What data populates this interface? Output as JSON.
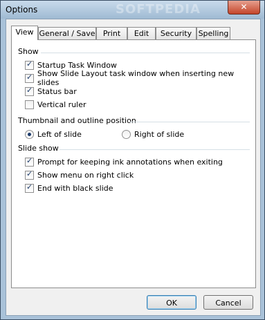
{
  "window": {
    "title": "Options",
    "watermark": "SOFTPEDIA",
    "close_label": "✕"
  },
  "tabs": [
    {
      "label": "View",
      "active": true
    },
    {
      "label": "General / Save",
      "active": false
    },
    {
      "label": "Print",
      "active": false
    },
    {
      "label": "Edit",
      "active": false
    },
    {
      "label": "Security",
      "active": false
    },
    {
      "label": "Spelling",
      "active": false
    }
  ],
  "show": {
    "heading": "Show",
    "options": [
      {
        "label": "Startup Task Window",
        "checked": true
      },
      {
        "label": "Show Slide Layout task window when inserting new slides",
        "checked": true
      },
      {
        "label": "Status bar",
        "checked": true
      },
      {
        "label": "Vertical ruler",
        "checked": false
      }
    ]
  },
  "thumbnail": {
    "heading": "Thumbnail and outline position",
    "options": [
      {
        "label": "Left of slide",
        "selected": true
      },
      {
        "label": "Right of slide",
        "selected": false
      }
    ]
  },
  "slideshow": {
    "heading": "Slide show",
    "options": [
      {
        "label": "Prompt for keeping ink annotations when exiting",
        "checked": true
      },
      {
        "label": "Show menu on right click",
        "checked": true
      },
      {
        "label": "End with black slide",
        "checked": true
      }
    ]
  },
  "buttons": {
    "ok": "OK",
    "cancel": "Cancel"
  }
}
